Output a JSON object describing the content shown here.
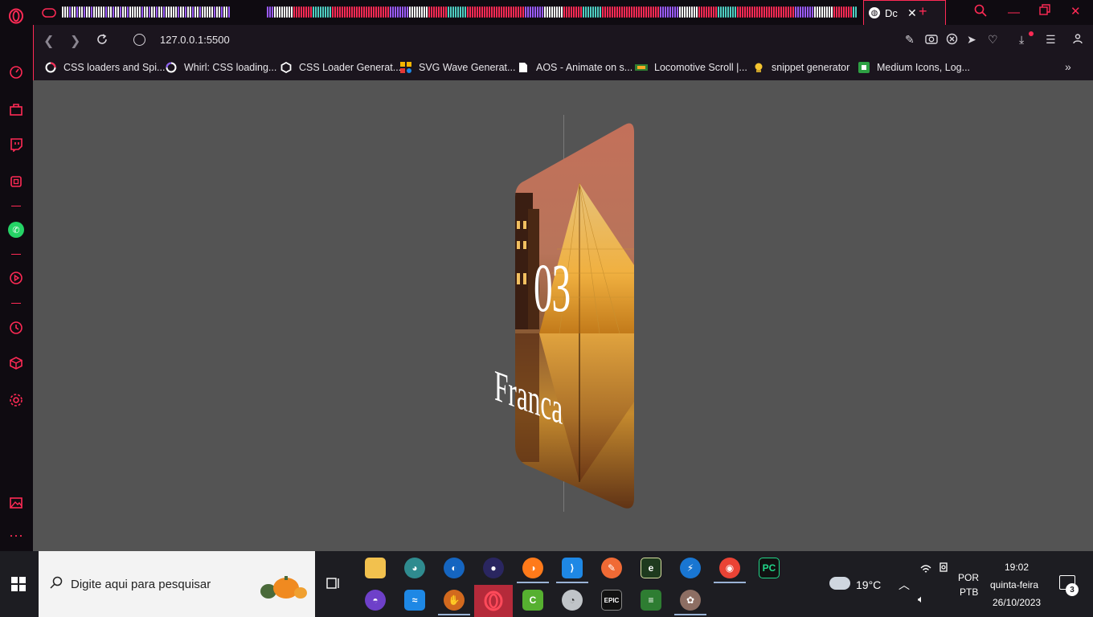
{
  "browser": {
    "active_tab_title": "Dc",
    "url": "127.0.0.1:5500",
    "accent_color": "#ff2a55"
  },
  "sidebar": {
    "items": [
      {
        "name": "opera-logo-icon"
      },
      {
        "name": "speed-dial-icon"
      },
      {
        "name": "shopping-icon"
      },
      {
        "name": "twitch-icon"
      },
      {
        "name": "ai-icon"
      },
      {
        "name": "whatsapp-icon"
      },
      {
        "name": "player-icon"
      },
      {
        "name": "history-icon"
      },
      {
        "name": "extensions-icon"
      },
      {
        "name": "settings-icon"
      },
      {
        "name": "gallery-icon"
      },
      {
        "name": "more-icon"
      }
    ]
  },
  "bookmarks": [
    {
      "label": "CSS loaders and Spi...",
      "icon": "spinner-icon"
    },
    {
      "label": "Whirl: CSS loading...",
      "icon": "whirl-icon"
    },
    {
      "label": "CSS Loader Generat...",
      "icon": "hexagon-icon"
    },
    {
      "label": "SVG Wave Generat...",
      "icon": "grid-icon"
    },
    {
      "label": "AOS - Animate on s...",
      "icon": "document-icon"
    },
    {
      "label": "Locomotive Scroll |...",
      "icon": "train-icon"
    },
    {
      "label": "snippet generator",
      "icon": "snippet-icon"
    },
    {
      "label": "Medium Icons, Log...",
      "icon": "medium-icon"
    }
  ],
  "card": {
    "number": "03",
    "name": "Franca"
  },
  "taskbar": {
    "search_placeholder": "Digite aqui para pesquisar",
    "weather": "19°C",
    "language_line1": "POR",
    "language_line2": "PTB",
    "time": "19:02",
    "weekday": "quinta-feira",
    "date": "26/10/2023",
    "notifications": "3"
  }
}
